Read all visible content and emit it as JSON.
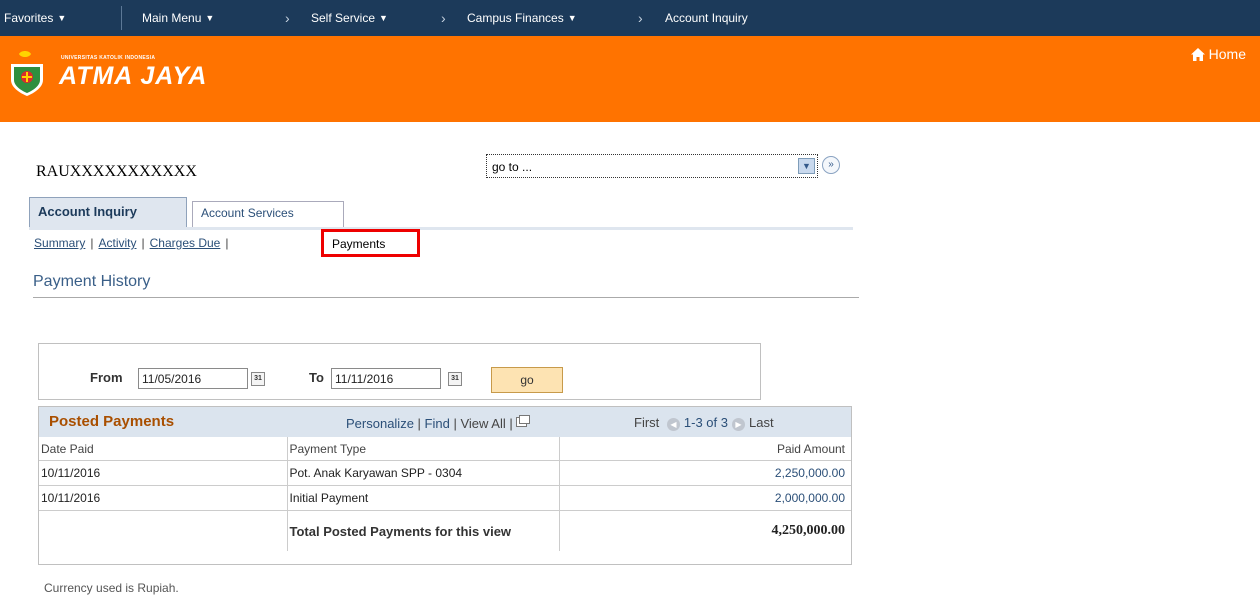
{
  "nav": {
    "favorites": "Favorites",
    "main_menu": "Main Menu",
    "self_service": "Self Service",
    "campus_finances": "Campus Finances",
    "account_inquiry": "Account Inquiry"
  },
  "banner": {
    "home": "Home",
    "logo_small": "UNIVERSITAS KATOLIK INDONESIA",
    "logo_big": "ATMA JAYA",
    "color": "#ff7300"
  },
  "student_id": "RAUXXXXXXXXXXX",
  "goto": {
    "value": "go to ..."
  },
  "tabs": [
    {
      "label": "Account Inquiry"
    },
    {
      "label": "Account Services"
    }
  ],
  "sublinks": {
    "summary_pre": "S",
    "summary_rest": "ummary",
    "activity_pre": "A",
    "activity_u": "c",
    "activity_rest": "tivity",
    "charges_pre": "C",
    "charges_u": "h",
    "charges_rest": "arges Due",
    "payments": "Payments"
  },
  "page_title": "Payment History",
  "filter": {
    "from_label": "From",
    "from_value": "11/05/2016",
    "to_label": "To",
    "to_value": "11/11/2016",
    "go_label": "go",
    "cal_glyph": "31"
  },
  "grid": {
    "title": "Posted Payments",
    "personalize": "Personalize",
    "find": "Find",
    "view_all": "View All",
    "first": "First",
    "range": "1-3 of 3",
    "last": "Last",
    "columns": [
      "Date Paid",
      "Payment Type",
      "Paid Amount"
    ],
    "rows": [
      {
        "date": "10/11/2016",
        "type": "Pot. Anak Karyawan SPP - 0304",
        "amount": "2,250,000.00"
      },
      {
        "date": "10/11/2016",
        "type": "Initial Payment",
        "amount": "2,000,000.00"
      }
    ],
    "total_label": "Total Posted Payments for this view",
    "total_amount": "4,250,000.00"
  },
  "currency_note": "Currency used is Rupiah."
}
